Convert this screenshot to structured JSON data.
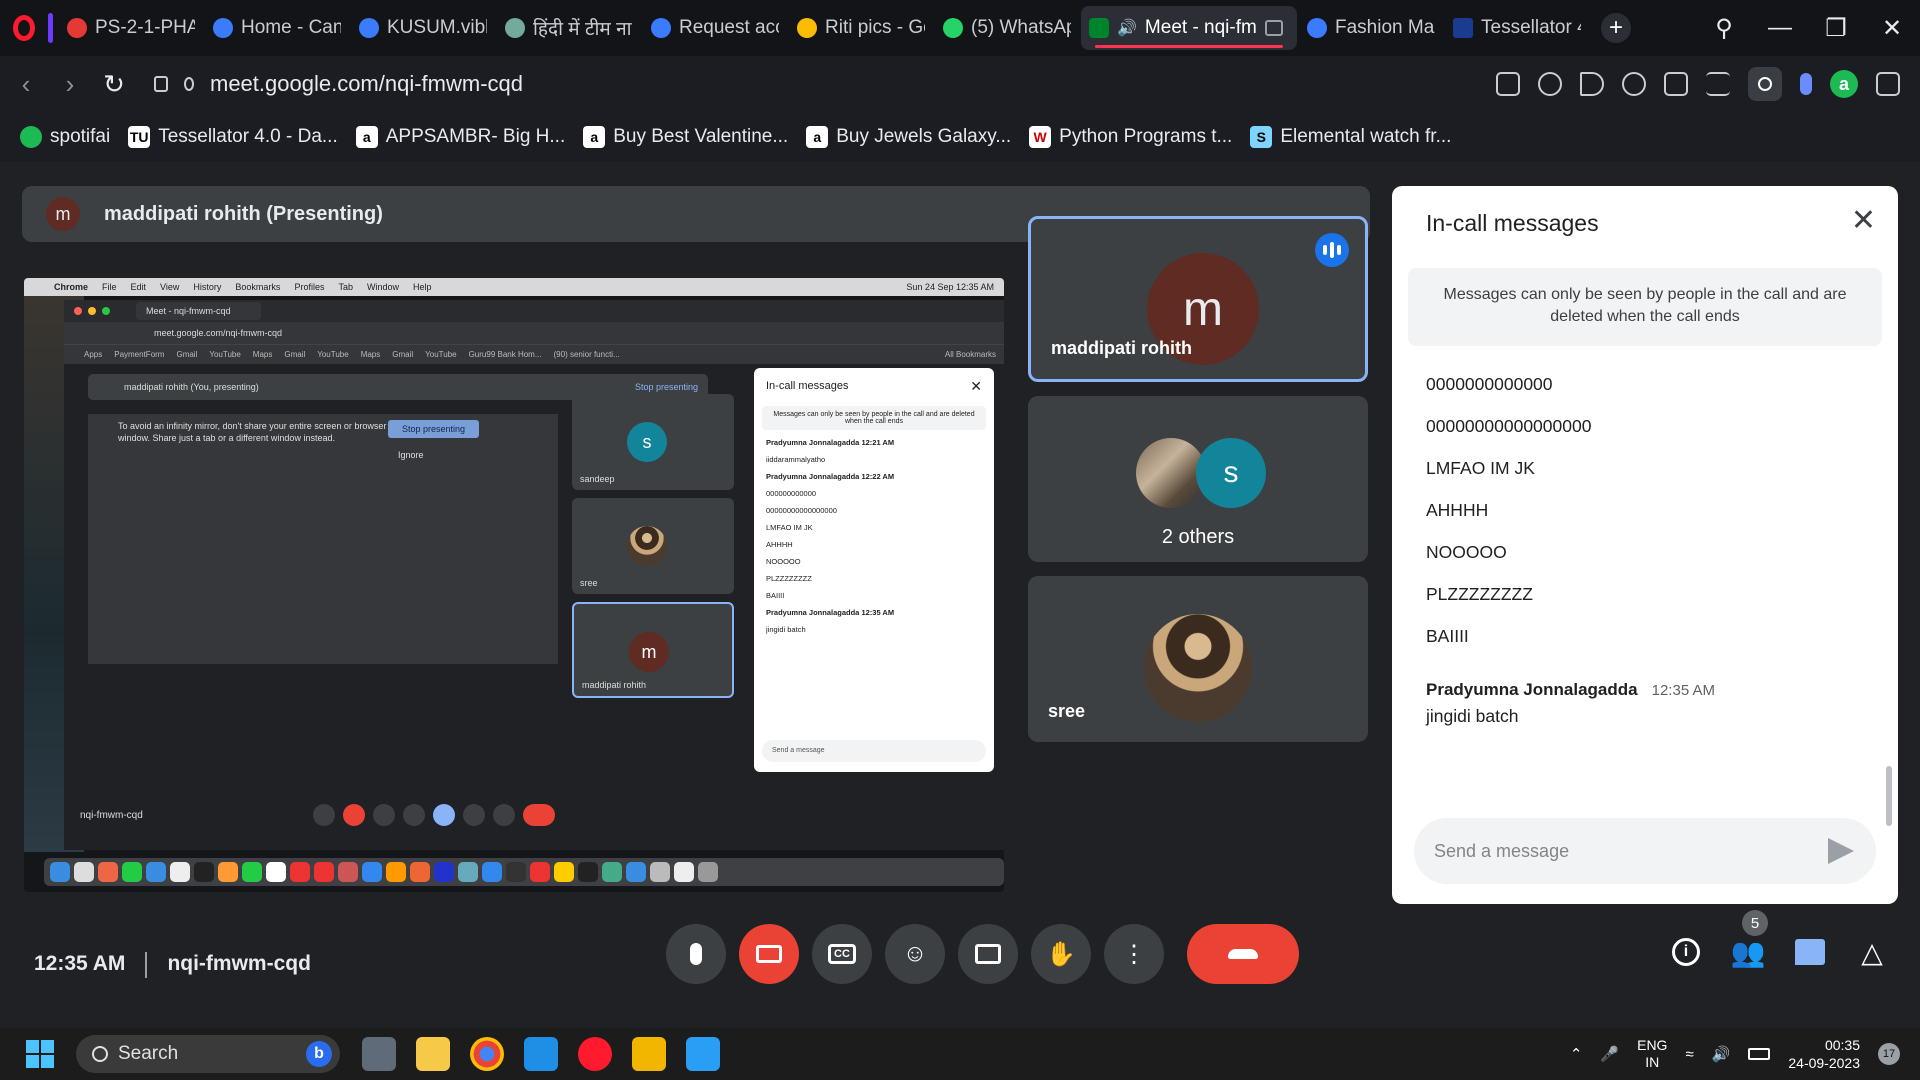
{
  "browser": {
    "tabs": [
      {
        "label": "PS-2-1-PHAS",
        "color": "#e53935"
      },
      {
        "label": "Home - Can",
        "color": "#3a7bff"
      },
      {
        "label": "KUSUM.vibh",
        "color": "#3a7bff"
      },
      {
        "label": "हिंदी में टीम ना",
        "color": "#74aa9c"
      },
      {
        "label": "Request acce",
        "color": "#3a7bff"
      },
      {
        "label": "Riti pics - Go",
        "color": "#fbbc04"
      },
      {
        "label": "(5) WhatsAp",
        "color": "#25d366"
      },
      {
        "label": "Meet - nqi-fm",
        "color": "#00832d",
        "active": true
      },
      {
        "label": "Fashion Mag",
        "color": "#3a7bff"
      },
      {
        "label": "Tessellator 4",
        "color": "#1a3c8f"
      }
    ],
    "url": "meet.google.com/nqi-fmwm-cqd",
    "bookmarks": [
      {
        "label": "spotifai",
        "color": "#1db954",
        "glyph": ""
      },
      {
        "label": "Tessellator 4.0 - Da...",
        "color": "#ffffff",
        "glyph": "TU"
      },
      {
        "label": "APPSAMBR- Big H...",
        "color": "#ffffff",
        "glyph": "a"
      },
      {
        "label": "Buy Best Valentine...",
        "color": "#ffffff",
        "glyph": "a"
      },
      {
        "label": "Buy Jewels Galaxy...",
        "color": "#ffffff",
        "glyph": "a"
      },
      {
        "label": "Python Programs t...",
        "color": "#ffffff",
        "glyph": "W"
      },
      {
        "label": "Elemental watch fr...",
        "color": "#7fd3ff",
        "glyph": "S"
      }
    ]
  },
  "meet": {
    "presenter_initial": "m",
    "presenter_label": "maddipati rohith (Presenting)",
    "shared_screen": {
      "mac_menu": [
        "Chrome",
        "File",
        "Edit",
        "View",
        "History",
        "Bookmarks",
        "Profiles",
        "Tab",
        "Window",
        "Help"
      ],
      "mac_clock": "Sun 24 Sep 12:35 AM",
      "tab_label": "Meet - nqi-fmwm-cqd",
      "url": "meet.google.com/nqi-fmwm-cqd",
      "bookmarks": [
        "Apps",
        "PaymentForm",
        "Gmail",
        "YouTube",
        "Maps",
        "Gmail",
        "YouTube",
        "Maps",
        "Gmail",
        "YouTube",
        "Guru99 Bank Hom...",
        "(90) senior functi..."
      ],
      "all_bookmarks": "All Bookmarks",
      "presenting_bar": "maddipati rohith (You, presenting)",
      "stop_presenting": "Stop presenting",
      "infinity_warning": "To avoid an infinity mirror, don't share your entire screen or browser window. Share just a tab or a different window instead.",
      "stop_presenting_button": "Stop presenting",
      "ignore": "Ignore",
      "tiles": [
        {
          "label": "sandeep",
          "initial": "s"
        },
        {
          "label": "sree",
          "initial": ""
        },
        {
          "label": "maddipati rohith",
          "initial": "m"
        }
      ],
      "chat_title": "In-call messages",
      "chat_notice": "Messages can only be seen by people in the call and are deleted when the call ends",
      "chat_lines": [
        "Pradyumna Jonnalagadda  12:21 AM",
        "iiddarammalyatho",
        "Pradyumna Jonnalagadda  12:22 AM",
        "000000000000",
        "00000000000000000",
        "LMFAO IM JK",
        "AHHHH",
        "NOOOOO",
        "PLZZZZZZZZ",
        "BAIIII",
        "Pradyumna Jonnalagadda  12:35 AM",
        "jingidi batch"
      ],
      "chat_send": "Send a message",
      "meeting_code": "nqi-fmwm-cqd"
    },
    "tiles": {
      "speaker": {
        "initial": "m",
        "name": "maddipati rohith"
      },
      "others": {
        "initial": "s",
        "label": "2 others"
      },
      "sree": {
        "name": "sree"
      }
    },
    "chat": {
      "title": "In-call messages",
      "notice": "Messages can only be seen by people in the call and are deleted when the call ends",
      "messages": [
        "0000000000000",
        "00000000000000000",
        "LMFAO IM JK",
        "AHHHH",
        "NOOOOO",
        "PLZZZZZZZZ",
        "BAIIII"
      ],
      "last_sender": "Pradyumna Jonnalagadda",
      "last_time": "12:35 AM",
      "last_message": "jingidi batch",
      "input_placeholder": "Send a message"
    },
    "bottom": {
      "time": "12:35 AM",
      "meeting_code": "nqi-fmwm-cqd",
      "participant_count": "5",
      "cc_label": "CC"
    }
  },
  "taskbar": {
    "search_label": "Search",
    "lang_line1": "ENG",
    "lang_line2": "IN",
    "time": "00:35",
    "date": "24-09-2023",
    "notification_count": "17"
  }
}
